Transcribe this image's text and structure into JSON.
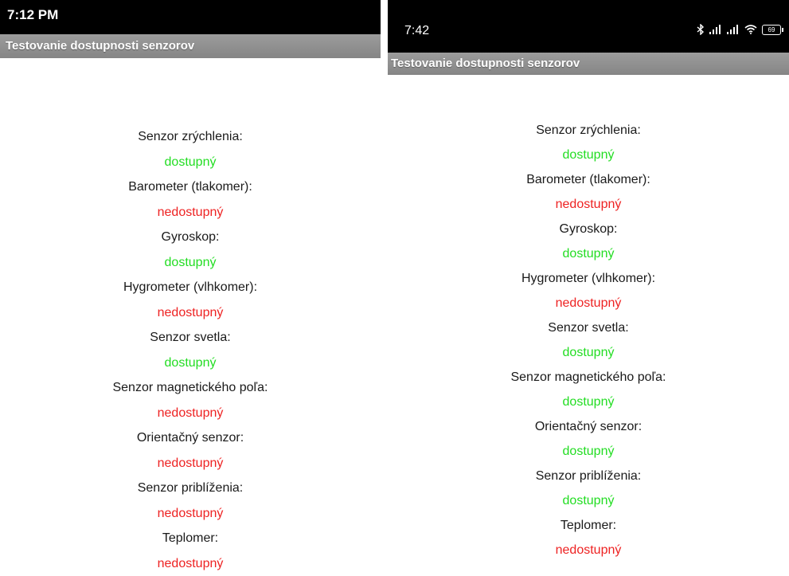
{
  "colors": {
    "available": "#22dd22",
    "unavailable": "#ee2222",
    "title_bar": "#8f8f8f",
    "status_bar": "#000000"
  },
  "left": {
    "time": "7:12 PM",
    "title": "Testovanie dostupnosti senzorov",
    "sensors": [
      {
        "label": "Senzor zrýchlenia:",
        "status": "dostupný",
        "available": true
      },
      {
        "label": "Barometer (tlakomer):",
        "status": "nedostupný",
        "available": false
      },
      {
        "label": "Gyroskop:",
        "status": "dostupný",
        "available": true
      },
      {
        "label": "Hygrometer (vlhkomer):",
        "status": "nedostupný",
        "available": false
      },
      {
        "label": "Senzor svetla:",
        "status": "dostupný",
        "available": true
      },
      {
        "label": "Senzor magnetického poľa:",
        "status": "nedostupný",
        "available": false
      },
      {
        "label": "Orientačný senzor:",
        "status": "nedostupný",
        "available": false
      },
      {
        "label": "Senzor priblíženia:",
        "status": "nedostupný",
        "available": false
      },
      {
        "label": "Teplomer:",
        "status": "nedostupný",
        "available": false
      }
    ]
  },
  "right": {
    "time": "7:42",
    "battery": "69",
    "status_icons": [
      "bluetooth-icon",
      "signal-icon",
      "signal-icon",
      "wifi-icon",
      "battery-icon"
    ],
    "title": "Testovanie dostupnosti senzorov",
    "sensors": [
      {
        "label": "Senzor zrýchlenia:",
        "status": "dostupný",
        "available": true
      },
      {
        "label": "Barometer (tlakomer):",
        "status": "nedostupný",
        "available": false
      },
      {
        "label": "Gyroskop:",
        "status": "dostupný",
        "available": true
      },
      {
        "label": "Hygrometer (vlhkomer):",
        "status": "nedostupný",
        "available": false
      },
      {
        "label": "Senzor svetla:",
        "status": "dostupný",
        "available": true
      },
      {
        "label": "Senzor magnetického poľa:",
        "status": "dostupný",
        "available": true
      },
      {
        "label": "Orientačný senzor:",
        "status": "dostupný",
        "available": true
      },
      {
        "label": "Senzor priblíženia:",
        "status": "dostupný",
        "available": true
      },
      {
        "label": "Teplomer:",
        "status": "nedostupný",
        "available": false
      }
    ]
  }
}
